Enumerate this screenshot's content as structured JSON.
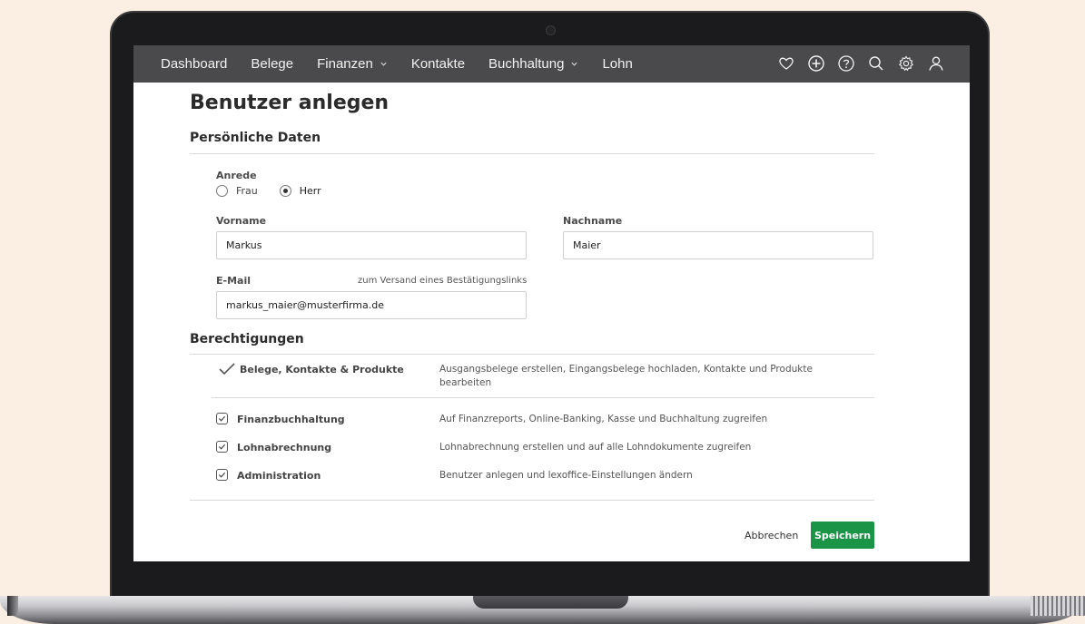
{
  "nav": {
    "items": [
      {
        "label": "Dashboard",
        "has_dropdown": false
      },
      {
        "label": "Belege",
        "has_dropdown": false
      },
      {
        "label": "Finanzen",
        "has_dropdown": true
      },
      {
        "label": "Kontakte",
        "has_dropdown": false
      },
      {
        "label": "Buchhaltung",
        "has_dropdown": true
      },
      {
        "label": "Lohn",
        "has_dropdown": false
      }
    ],
    "icons": [
      "heart-icon",
      "plus-circle-icon",
      "help-icon",
      "search-icon",
      "settings-icon",
      "user-icon"
    ]
  },
  "page": {
    "title": "Benutzer anlegen",
    "personal_section": "Persönliche Daten",
    "salutation_label": "Anrede",
    "salutation_options": [
      "Frau",
      "Herr"
    ],
    "salutation_selected": "Herr",
    "first_name_label": "Vorname",
    "first_name_value": "Markus",
    "last_name_label": "Nachname",
    "last_name_value": "Maier",
    "email_label": "E-Mail",
    "email_hint": "zum Versand eines Bestätigungslinks",
    "email_value": "markus_maier@musterfirma.de",
    "permissions_section": "Berechtigungen",
    "permissions": [
      {
        "name": "Belege, Kontakte & Produkte",
        "description": "Ausgangsbelege erstellen, Eingangsbelege hochladen, Kontakte und Produkte bearbeiten",
        "style": "check"
      },
      {
        "name": "Finanzbuchhaltung",
        "description": "Auf Finanzreports, Online-Banking, Kasse und Buchhaltung zugreifen",
        "style": "checkbox"
      },
      {
        "name": "Lohnabrechnung",
        "description": "Lohnabrechnung erstellen und auf alle Lohndokumente zugreifen",
        "style": "checkbox"
      },
      {
        "name": "Administration",
        "description": "Benutzer anlegen und lexoffice-Einstellungen ändern",
        "style": "checkbox"
      }
    ],
    "cancel_label": "Abbrechen",
    "save_label": "Speichern"
  },
  "colors": {
    "navbar": "#4a4a4c",
    "accent_green": "#1a9447",
    "background": "#fbefe4"
  }
}
